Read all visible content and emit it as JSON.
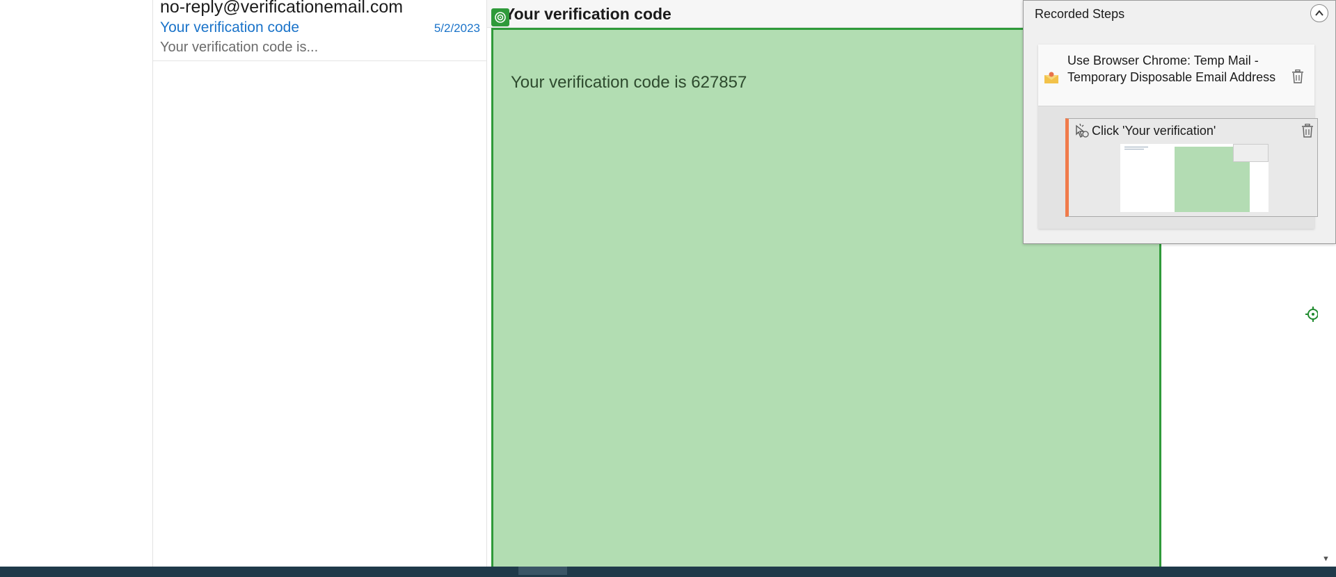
{
  "message_list": {
    "items": [
      {
        "from": "no-reply@verificationemail.com",
        "subject": "Your verification code",
        "date": "5/2/2023",
        "preview": "Your verification code is..."
      }
    ]
  },
  "reading_pane": {
    "subject": "Your verification code",
    "body": "Your verification code is 627857",
    "highlight_color": "#2f9a3a"
  },
  "recorded_steps": {
    "title": "Recorded Steps",
    "group": {
      "title": "Use Browser Chrome: Temp Mail - Temporary Disposable Email Address",
      "icon": "mail-icon",
      "steps": [
        {
          "title": "Click 'Your verification'",
          "icon": "click-icon",
          "accent_color": "#f07b4b"
        }
      ]
    }
  }
}
